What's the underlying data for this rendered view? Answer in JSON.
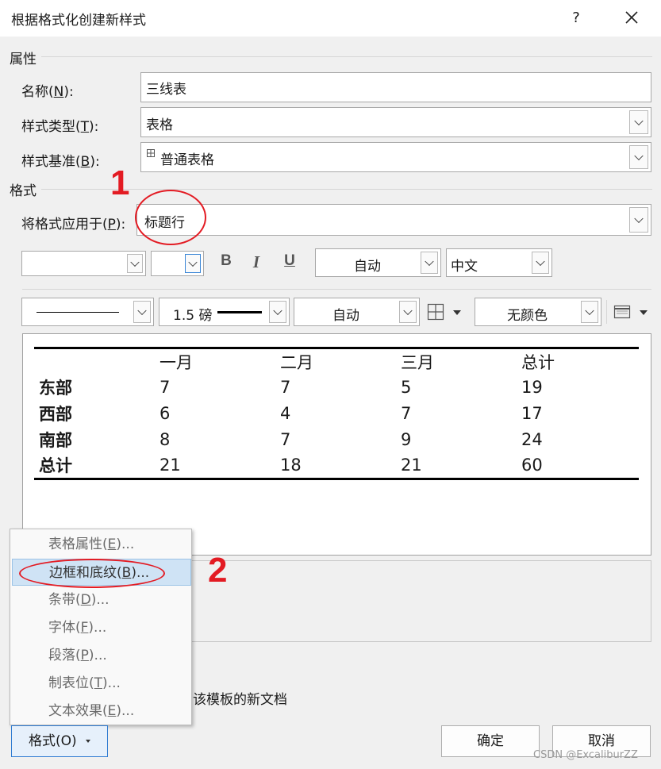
{
  "window": {
    "title": "根据格式化创建新样式",
    "help": "?"
  },
  "properties": {
    "section_label": "属性",
    "name": {
      "label": "名称(",
      "mnemonic": "N",
      "label_end": "):",
      "value": "三线表"
    },
    "style_type": {
      "label": "样式类型(",
      "mnemonic": "T",
      "label_end": "):",
      "value": "表格"
    },
    "style_base": {
      "label": "样式基准(",
      "mnemonic": "B",
      "label_end": "):",
      "value": "普通表格",
      "icon": "table-icon"
    }
  },
  "format": {
    "section_label": "格式",
    "apply_to": {
      "label": "将格式应用于(",
      "mnemonic": "P",
      "label_end": "):",
      "value": "标题行"
    },
    "toolbar1": {
      "bold": "B",
      "italic": "I",
      "underline": "U",
      "font_color": "自动",
      "script": "中文"
    },
    "toolbar2": {
      "border_width": "1.5 磅",
      "border_color": "自动",
      "shading": "无颜色"
    }
  },
  "preview_table": {
    "headers": [
      "",
      "一月",
      "二月",
      "三月",
      "总计"
    ],
    "rows": [
      [
        "东部",
        "7",
        "7",
        "5",
        "19"
      ],
      [
        "西部",
        "6",
        "4",
        "7",
        "17"
      ],
      [
        "南部",
        "8",
        "7",
        "9",
        "24"
      ],
      [
        "总计",
        "21",
        "18",
        "21",
        "60"
      ]
    ]
  },
  "background_text": {
    "template_tail": "该模板的新文档"
  },
  "format_menu": {
    "items": [
      {
        "label": "表格属性(",
        "mnemonic": "E",
        "tail": ")..."
      },
      {
        "label": "边框和底纹(",
        "mnemonic": "B",
        "tail": ")..."
      },
      {
        "label": "条带(",
        "mnemonic": "D",
        "tail": ")..."
      },
      {
        "label": "字体(",
        "mnemonic": "F",
        "tail": ")..."
      },
      {
        "label": "段落(",
        "mnemonic": "P",
        "tail": ")..."
      },
      {
        "label": "制表位(",
        "mnemonic": "T",
        "tail": ")..."
      },
      {
        "label": "文本效果(",
        "mnemonic": "E",
        "tail": ")..."
      }
    ]
  },
  "buttons": {
    "format": "格式(O)",
    "ok": "确定",
    "cancel": "取消"
  },
  "annotations": {
    "one": "1",
    "two": "2",
    "color": "#e31b23"
  },
  "watermark": "CSDN @ExcaliburZZ"
}
